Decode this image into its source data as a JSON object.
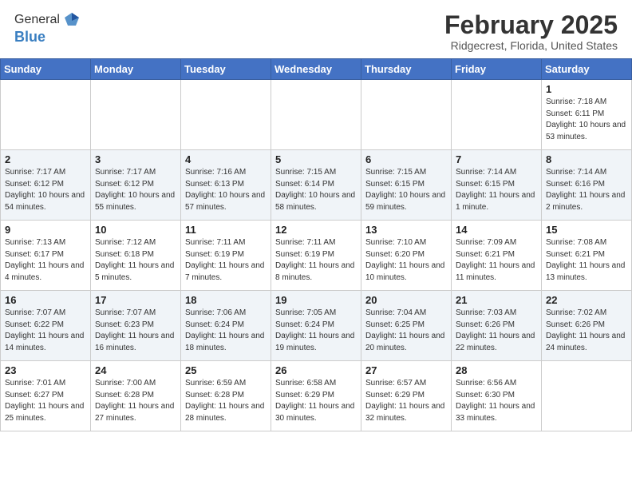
{
  "logo": {
    "general": "General",
    "blue": "Blue"
  },
  "header": {
    "month": "February 2025",
    "location": "Ridgecrest, Florida, United States"
  },
  "weekdays": [
    "Sunday",
    "Monday",
    "Tuesday",
    "Wednesday",
    "Thursday",
    "Friday",
    "Saturday"
  ],
  "weeks": [
    [
      {
        "day": "",
        "info": ""
      },
      {
        "day": "",
        "info": ""
      },
      {
        "day": "",
        "info": ""
      },
      {
        "day": "",
        "info": ""
      },
      {
        "day": "",
        "info": ""
      },
      {
        "day": "",
        "info": ""
      },
      {
        "day": "1",
        "info": "Sunrise: 7:18 AM\nSunset: 6:11 PM\nDaylight: 10 hours\nand 53 minutes."
      }
    ],
    [
      {
        "day": "2",
        "info": "Sunrise: 7:17 AM\nSunset: 6:12 PM\nDaylight: 10 hours\nand 54 minutes."
      },
      {
        "day": "3",
        "info": "Sunrise: 7:17 AM\nSunset: 6:12 PM\nDaylight: 10 hours\nand 55 minutes."
      },
      {
        "day": "4",
        "info": "Sunrise: 7:16 AM\nSunset: 6:13 PM\nDaylight: 10 hours\nand 57 minutes."
      },
      {
        "day": "5",
        "info": "Sunrise: 7:15 AM\nSunset: 6:14 PM\nDaylight: 10 hours\nand 58 minutes."
      },
      {
        "day": "6",
        "info": "Sunrise: 7:15 AM\nSunset: 6:15 PM\nDaylight: 10 hours\nand 59 minutes."
      },
      {
        "day": "7",
        "info": "Sunrise: 7:14 AM\nSunset: 6:15 PM\nDaylight: 11 hours\nand 1 minute."
      },
      {
        "day": "8",
        "info": "Sunrise: 7:14 AM\nSunset: 6:16 PM\nDaylight: 11 hours\nand 2 minutes."
      }
    ],
    [
      {
        "day": "9",
        "info": "Sunrise: 7:13 AM\nSunset: 6:17 PM\nDaylight: 11 hours\nand 4 minutes."
      },
      {
        "day": "10",
        "info": "Sunrise: 7:12 AM\nSunset: 6:18 PM\nDaylight: 11 hours\nand 5 minutes."
      },
      {
        "day": "11",
        "info": "Sunrise: 7:11 AM\nSunset: 6:19 PM\nDaylight: 11 hours\nand 7 minutes."
      },
      {
        "day": "12",
        "info": "Sunrise: 7:11 AM\nSunset: 6:19 PM\nDaylight: 11 hours\nand 8 minutes."
      },
      {
        "day": "13",
        "info": "Sunrise: 7:10 AM\nSunset: 6:20 PM\nDaylight: 11 hours\nand 10 minutes."
      },
      {
        "day": "14",
        "info": "Sunrise: 7:09 AM\nSunset: 6:21 PM\nDaylight: 11 hours\nand 11 minutes."
      },
      {
        "day": "15",
        "info": "Sunrise: 7:08 AM\nSunset: 6:21 PM\nDaylight: 11 hours\nand 13 minutes."
      }
    ],
    [
      {
        "day": "16",
        "info": "Sunrise: 7:07 AM\nSunset: 6:22 PM\nDaylight: 11 hours\nand 14 minutes."
      },
      {
        "day": "17",
        "info": "Sunrise: 7:07 AM\nSunset: 6:23 PM\nDaylight: 11 hours\nand 16 minutes."
      },
      {
        "day": "18",
        "info": "Sunrise: 7:06 AM\nSunset: 6:24 PM\nDaylight: 11 hours\nand 18 minutes."
      },
      {
        "day": "19",
        "info": "Sunrise: 7:05 AM\nSunset: 6:24 PM\nDaylight: 11 hours\nand 19 minutes."
      },
      {
        "day": "20",
        "info": "Sunrise: 7:04 AM\nSunset: 6:25 PM\nDaylight: 11 hours\nand 20 minutes."
      },
      {
        "day": "21",
        "info": "Sunrise: 7:03 AM\nSunset: 6:26 PM\nDaylight: 11 hours\nand 22 minutes."
      },
      {
        "day": "22",
        "info": "Sunrise: 7:02 AM\nSunset: 6:26 PM\nDaylight: 11 hours\nand 24 minutes."
      }
    ],
    [
      {
        "day": "23",
        "info": "Sunrise: 7:01 AM\nSunset: 6:27 PM\nDaylight: 11 hours\nand 25 minutes."
      },
      {
        "day": "24",
        "info": "Sunrise: 7:00 AM\nSunset: 6:28 PM\nDaylight: 11 hours\nand 27 minutes."
      },
      {
        "day": "25",
        "info": "Sunrise: 6:59 AM\nSunset: 6:28 PM\nDaylight: 11 hours\nand 28 minutes."
      },
      {
        "day": "26",
        "info": "Sunrise: 6:58 AM\nSunset: 6:29 PM\nDaylight: 11 hours\nand 30 minutes."
      },
      {
        "day": "27",
        "info": "Sunrise: 6:57 AM\nSunset: 6:29 PM\nDaylight: 11 hours\nand 32 minutes."
      },
      {
        "day": "28",
        "info": "Sunrise: 6:56 AM\nSunset: 6:30 PM\nDaylight: 11 hours\nand 33 minutes."
      },
      {
        "day": "",
        "info": ""
      }
    ]
  ]
}
